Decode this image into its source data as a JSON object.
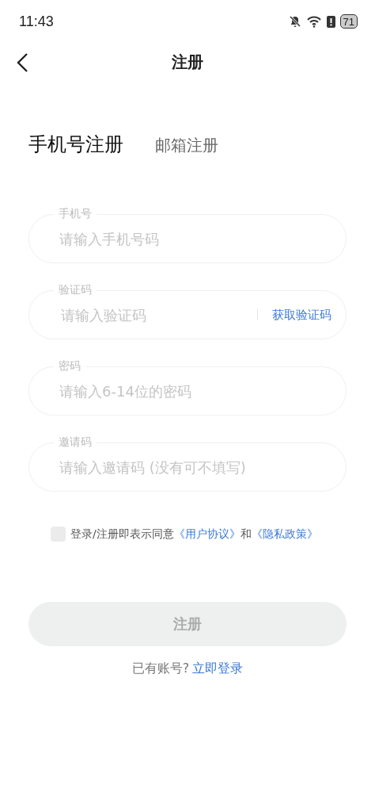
{
  "status_bar": {
    "time": "11:43",
    "battery": "71"
  },
  "nav": {
    "title": "注册"
  },
  "tabs": [
    {
      "label": "手机号注册",
      "selected": true
    },
    {
      "label": "邮箱注册",
      "selected": false
    }
  ],
  "fields": [
    {
      "label": "手机号",
      "placeholder": "请输入手机号码"
    },
    {
      "label": "验证码",
      "placeholder": "请输入验证码",
      "action": "获取验证码"
    },
    {
      "label": "密码",
      "placeholder": "请输入6-14位的密码"
    },
    {
      "label": "邀请码",
      "placeholder": "请输入邀请码 (没有可不填写)"
    }
  ],
  "agreement": {
    "checked": false,
    "text": "登录/注册即表示同意",
    "link_1": "《用户协议》",
    "joiner": "和",
    "link_2": "《隐私政策》"
  },
  "submit": {
    "label": "注册",
    "disabled": true
  },
  "login_prompt": {
    "text": "已有账号?",
    "link": "立即登录"
  }
}
